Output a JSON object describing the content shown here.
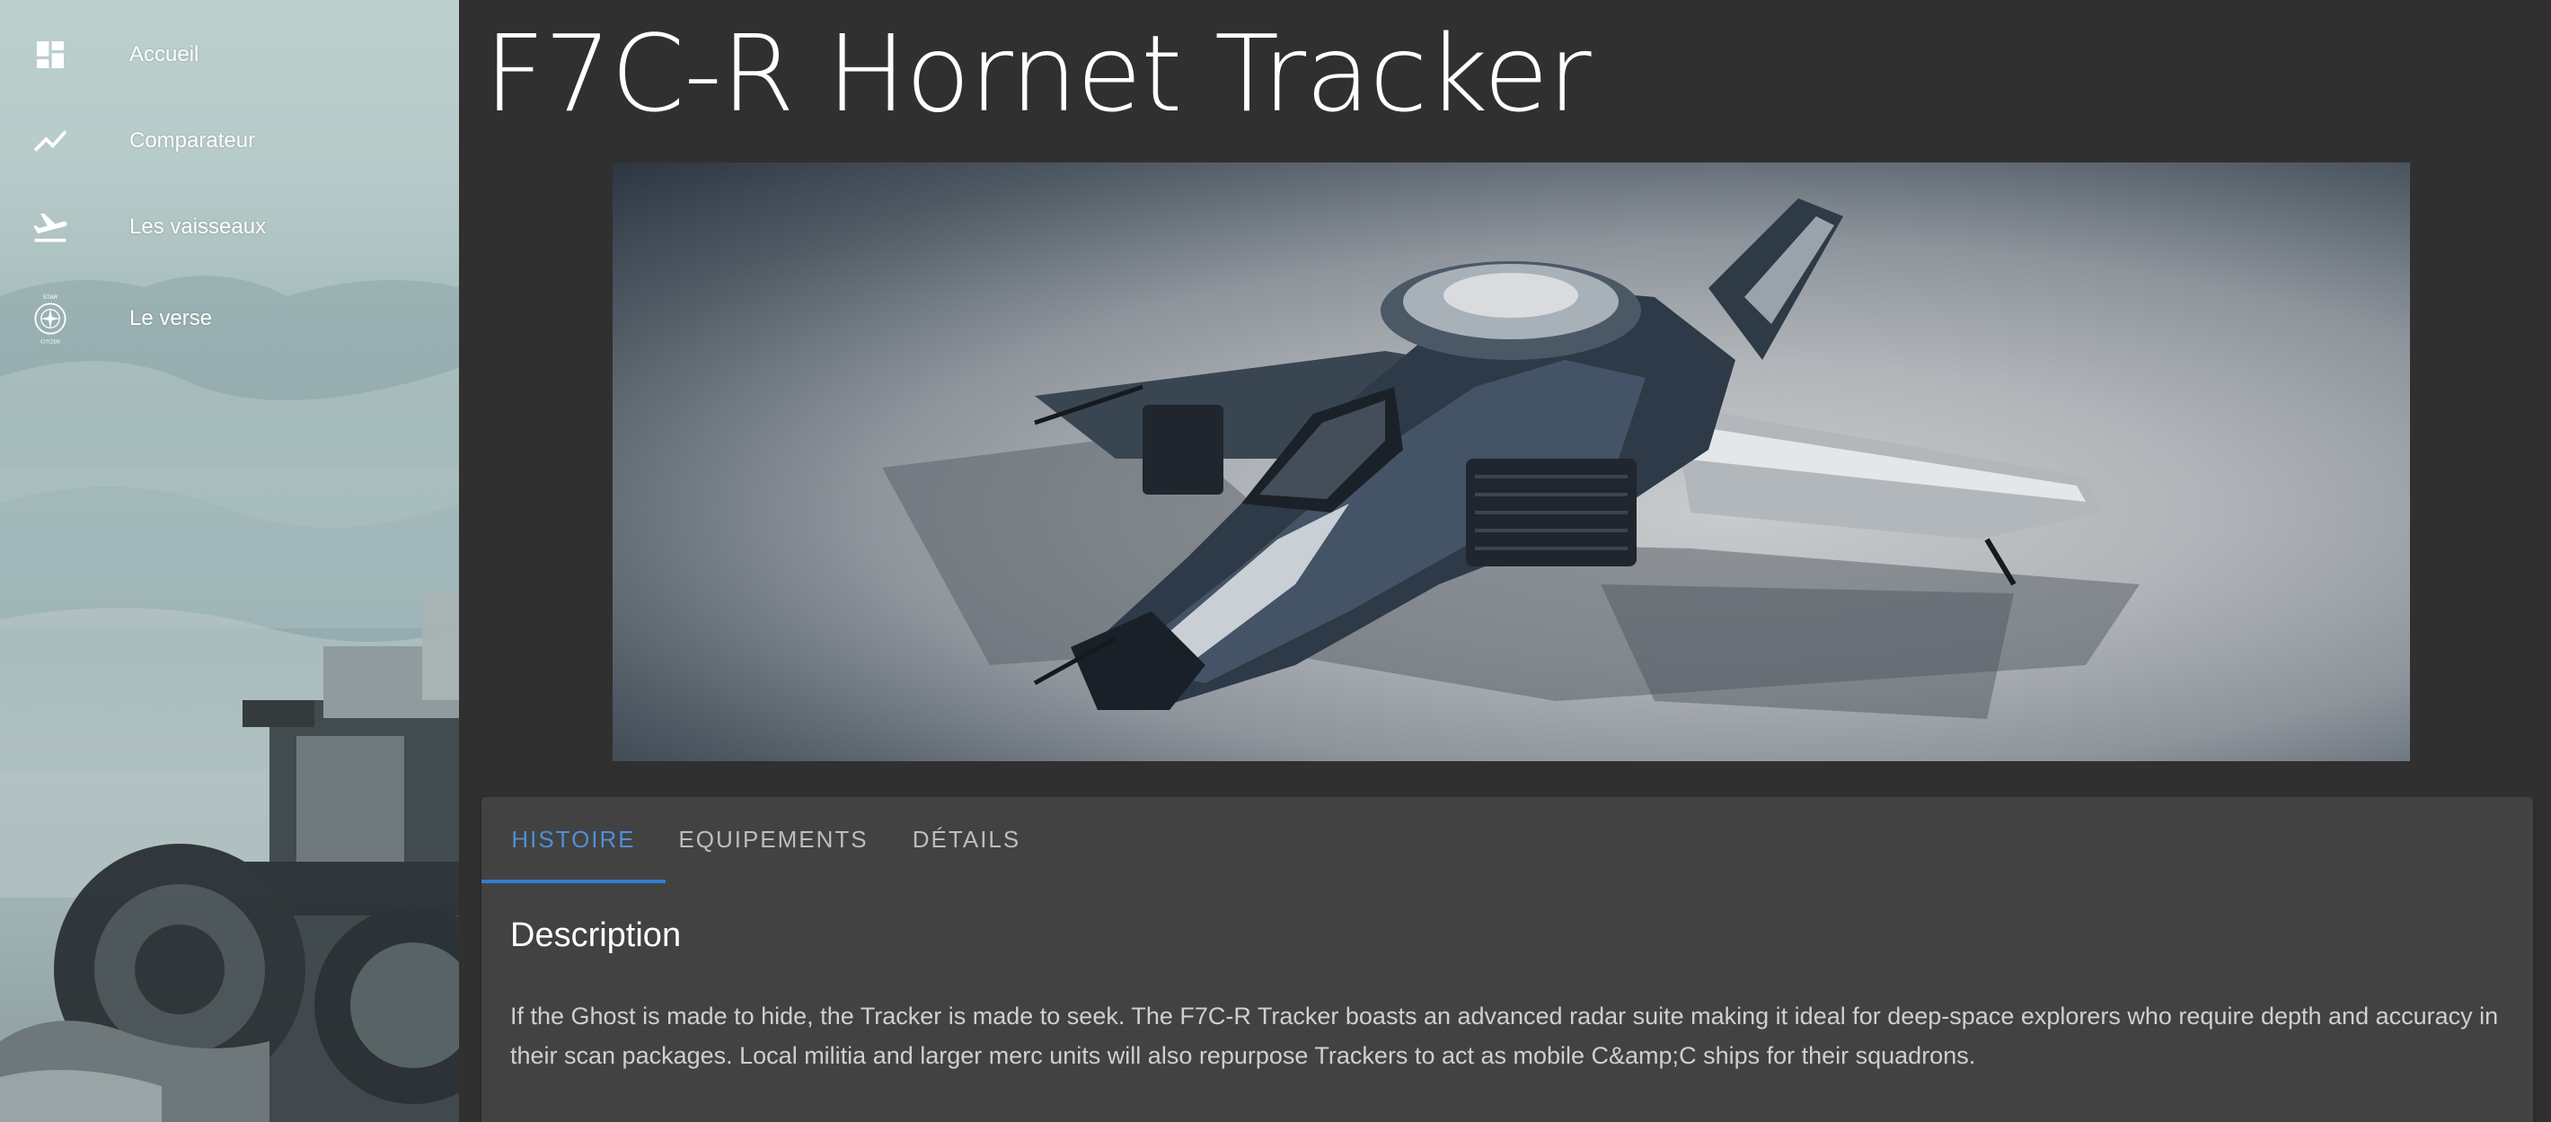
{
  "sidebar": {
    "items": [
      {
        "label": "Accueil",
        "icon": "dashboard-icon"
      },
      {
        "label": "Comparateur",
        "icon": "trending-line-icon"
      },
      {
        "label": "Les vaisseaux",
        "icon": "flight-takeoff-icon"
      },
      {
        "label": "Le verse",
        "icon": "star-citizen-logo-icon"
      }
    ],
    "logo_text": {
      "top": "STAR",
      "bottom": "CITIZEN"
    }
  },
  "main": {
    "title": "F7C-R Hornet Tracker",
    "hero_image": "ship-render-hornet-tracker",
    "tabs": [
      {
        "label": "HISTOIRE",
        "active": true
      },
      {
        "label": "EQUIPEMENTS",
        "active": false
      },
      {
        "label": "DÉTAILS",
        "active": false
      }
    ],
    "description_title": "Description",
    "description_text": "If the Ghost is made to hide, the Tracker is made to seek. The F7C-R Tracker boasts an advanced radar suite making it ideal for deep-space explorers who require depth and accuracy in their scan packages. Local militia and larger merc units will also repurpose Trackers to act as mobile C&amp;C ships for their squadrons."
  },
  "colors": {
    "background": "#303030",
    "card": "#424242",
    "accent": "#2f7fd4",
    "active_tab_text": "#4f8fd6",
    "inactive_tab_text": "#bdbdbd"
  }
}
